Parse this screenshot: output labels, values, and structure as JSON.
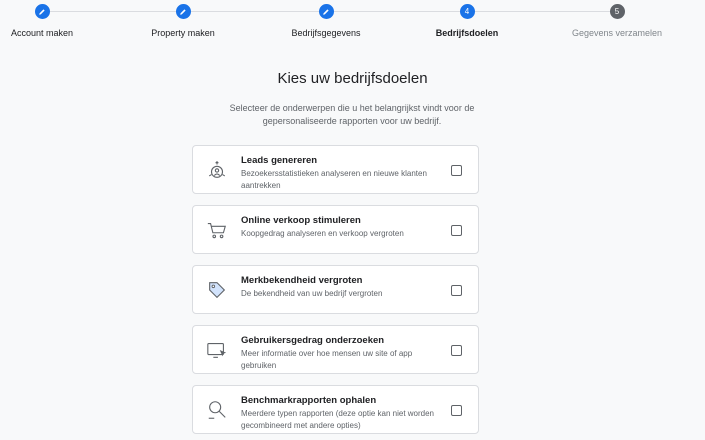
{
  "stepper": {
    "steps": [
      {
        "label": "Account maken",
        "state": "done",
        "icon": "pencil-icon"
      },
      {
        "label": "Property maken",
        "state": "done",
        "icon": "pencil-icon"
      },
      {
        "label": "Bedrijfsgegevens",
        "state": "done",
        "icon": "pencil-icon"
      },
      {
        "label": "Bedrijfsdoelen",
        "state": "active",
        "number": "4"
      },
      {
        "label": "Gegevens verzamelen",
        "state": "pending",
        "number": "5"
      }
    ]
  },
  "heading": "Kies uw bedrijfsdoelen",
  "subtitle": "Selecteer de onderwerpen die u het belangrijkst vindt voor de gepersonaliseerde rapporten voor uw bedrijf.",
  "goals": [
    {
      "title": "Leads genereren",
      "description": "Bezoekersstatistieken analyseren en nieuwe klanten aantrekken",
      "icon": "leads-icon",
      "checked": false
    },
    {
      "title": "Online verkoop stimuleren",
      "description": "Koopgedrag analyseren en verkoop vergroten",
      "icon": "cart-icon",
      "checked": false
    },
    {
      "title": "Merkbekendheid vergroten",
      "description": "De bekendheid van uw bedrijf vergroten",
      "icon": "tag-icon",
      "checked": false
    },
    {
      "title": "Gebruikersgedrag onderzoeken",
      "description": "Meer informatie over hoe mensen uw site of app gebruiken",
      "icon": "screen-cursor-icon",
      "checked": false
    },
    {
      "title": "Benchmarkrapporten ophalen",
      "description": "Meerdere typen rapporten (deze optie kan niet worden gecombineerd met andere opties)",
      "icon": "magnifier-icon",
      "checked": false
    }
  ],
  "colors": {
    "accent": "#1a73e8",
    "pending": "#5f6368",
    "border": "#dadce0",
    "background": "#f8f9fa"
  }
}
